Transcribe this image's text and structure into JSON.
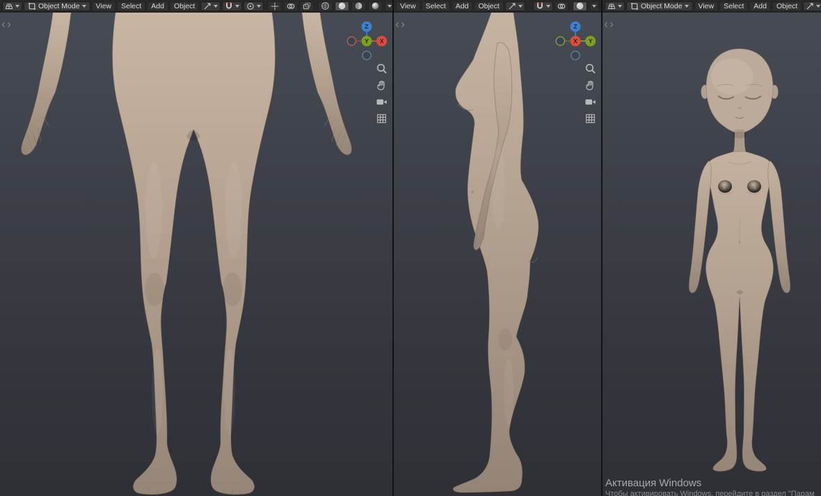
{
  "header": {
    "mode_label": "Object Mode",
    "menus": {
      "view": "View",
      "select": "Select",
      "add": "Add",
      "object": "Object"
    }
  },
  "gizmo_front": {
    "up": "Z",
    "center": "Y",
    "right": "X"
  },
  "gizmo_side": {
    "up": "Z",
    "center": "X",
    "right": "Y"
  },
  "viewports": [
    {
      "name": "front-view-lower-body",
      "content": "female base-mesh, front view, legs and hands"
    },
    {
      "name": "side-view-full-body",
      "content": "female base-mesh, side profile view"
    },
    {
      "name": "front-view-full-body",
      "content": "stylized female base-mesh, full front view"
    }
  ],
  "watermark": {
    "title": "Активация Windows",
    "subtitle": "Чтобы активировать Windows, перейдите в раздел \"Парам"
  },
  "icons": {
    "editor_type": "viewport-editor-icon",
    "mode": "object-mode-icon",
    "dropdown": "chevron-down-icon",
    "transform_orientation": "transform-orientation-icon",
    "snap": "magnet-icon",
    "proportional_editing": "proportional-editing-icon",
    "show_gizmo": "gizmo-overlay-icon",
    "overlays": "overlays-icon",
    "xray": "xray-icon",
    "shading": [
      "wireframe-sphere-icon",
      "solid-sphere-icon",
      "material-sphere-icon",
      "rendered-sphere-icon"
    ],
    "viewport_tools": [
      "zoom-icon",
      "pan-hand-icon",
      "camera-icon",
      "grid-icon"
    ],
    "sidebar_toggle": "sidebar-toggle-icon"
  },
  "colors": {
    "header_bg": "#282828",
    "viewport_bg": "#3c3f47",
    "skin": "#b4a190",
    "axis_x": "#dd4b3f",
    "axis_y": "#7aa21d",
    "axis_z": "#3a7fd0"
  }
}
